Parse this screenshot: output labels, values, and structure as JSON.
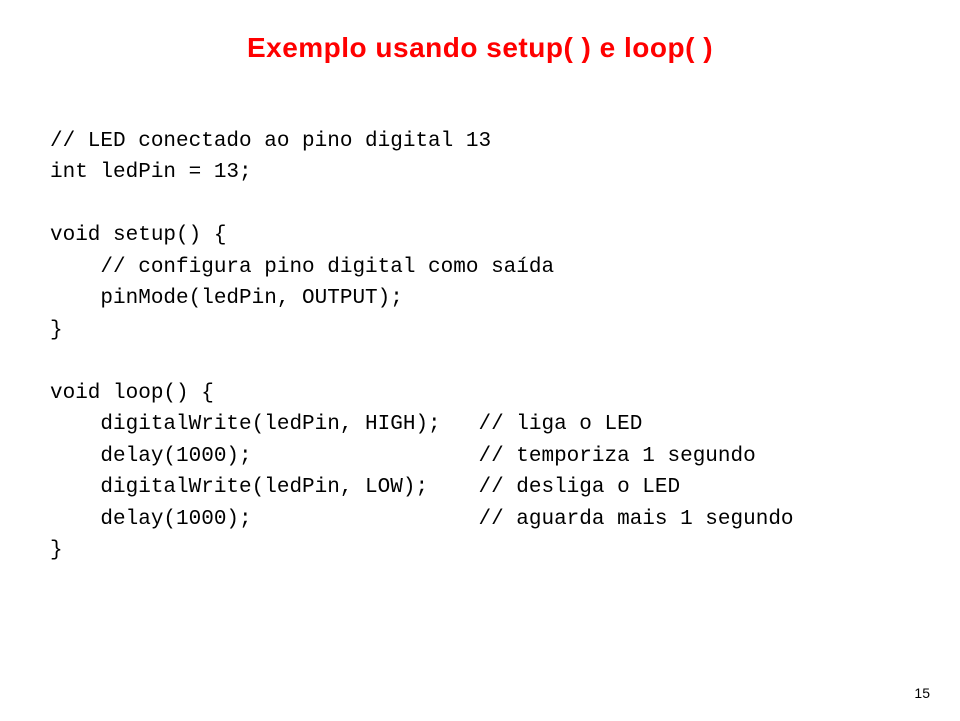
{
  "title": "Exemplo usando setup( ) e loop( )",
  "code": {
    "line1": "// LED conectado ao pino digital 13",
    "line2": "int ledPin = 13;",
    "line3": "",
    "line4": "void setup() {",
    "line5": "    // configura pino digital como saída",
    "line6": "    pinMode(ledPin, OUTPUT);",
    "line7": "}",
    "line8": "",
    "line9": "void loop() {",
    "line10": "    digitalWrite(ledPin, HIGH);   // liga o LED",
    "line11": "    delay(1000);                  // temporiza 1 segundo",
    "line12": "    digitalWrite(ledPin, LOW);    // desliga o LED",
    "line13": "    delay(1000);                  // aguarda mais 1 segundo",
    "line14": "}"
  },
  "page_number": "15"
}
